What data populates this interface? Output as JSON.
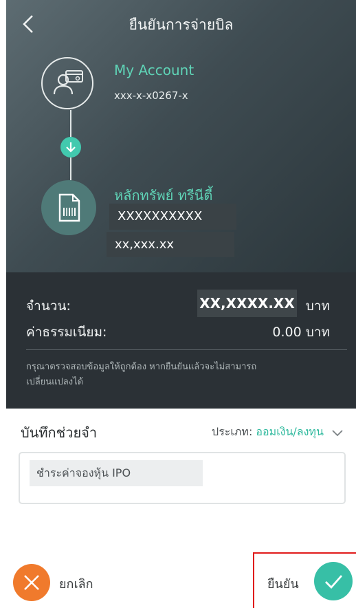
{
  "header": {
    "title": "ยืนยันการจ่ายบิล"
  },
  "from": {
    "label": "My Account",
    "account_number": "xxx-x-x0267-x"
  },
  "to": {
    "label": "หลักทรัพย์ ทรีนีตี้",
    "ref1": "XXXXXXXXXX",
    "ref2": "xx,xxx.xx"
  },
  "summary": {
    "amount_label": "จำนวน:",
    "amount_value": "XX,XXXX.XX",
    "amount_unit": "บาท",
    "fee_label": "ค่าธรรมเนียม:",
    "fee_value": "0.00",
    "fee_unit": "บาท",
    "note_line1": "กรุณาตรวจสอบข้อมูลให้ถูกต้อง หากยืนยันแล้วจะไม่สามารถ",
    "note_line2": "เปลี่ยนแปลงได้"
  },
  "memo": {
    "title": "บันทึกช่วยจำ",
    "type_label": "ประเภท:",
    "type_value": "ออมเงิน/ลงทุน",
    "text": "ชำระค่าจองหุ้น IPO"
  },
  "actions": {
    "cancel": "ยกเลิก",
    "confirm": "ยืนยัน"
  },
  "colors": {
    "accent": "#37bfa6",
    "cancel": "#f07a2c",
    "highlight": "#e01b1b"
  }
}
